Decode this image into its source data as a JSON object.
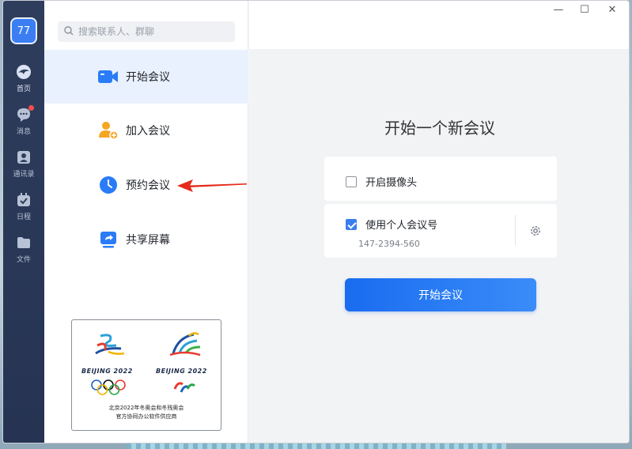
{
  "user": {
    "avatar_text": "77"
  },
  "rail": [
    {
      "label": "首页",
      "icon": "home-icon"
    },
    {
      "label": "消息",
      "icon": "chat-icon"
    },
    {
      "label": "通讯录",
      "icon": "contacts-icon"
    },
    {
      "label": "日程",
      "icon": "calendar-icon"
    },
    {
      "label": "文件",
      "icon": "folder-icon"
    }
  ],
  "search": {
    "placeholder": "搜索联系人、群聊"
  },
  "menu": [
    {
      "label": "开始会议",
      "icon": "video-camera-icon",
      "color": "#2a7cf6"
    },
    {
      "label": "加入会议",
      "icon": "add-user-icon",
      "color": "#f5a623"
    },
    {
      "label": "预约会议",
      "icon": "clock-icon",
      "color": "#2a7cf6"
    },
    {
      "label": "共享屏幕",
      "icon": "share-screen-icon",
      "color": "#2a7cf6"
    }
  ],
  "olympic": {
    "logo_left_text": "BEIJING 2022",
    "logo_right_text": "BEIJING 2022",
    "caption_line1": "北京2022年冬奥会和冬残奥会",
    "caption_line2": "官方协同办公软件供应商"
  },
  "window_controls": {
    "minimize": "—",
    "maximize": "☐",
    "close": "✕"
  },
  "main": {
    "title": "开始一个新会议",
    "camera_label": "开启摄像头",
    "personal_id_label": "使用个人会议号",
    "personal_id_value": "147-2394-560",
    "start_button": "开始会议"
  },
  "colors": {
    "accent": "#2a7cf6",
    "rail_bg": "#2f3d5d"
  }
}
